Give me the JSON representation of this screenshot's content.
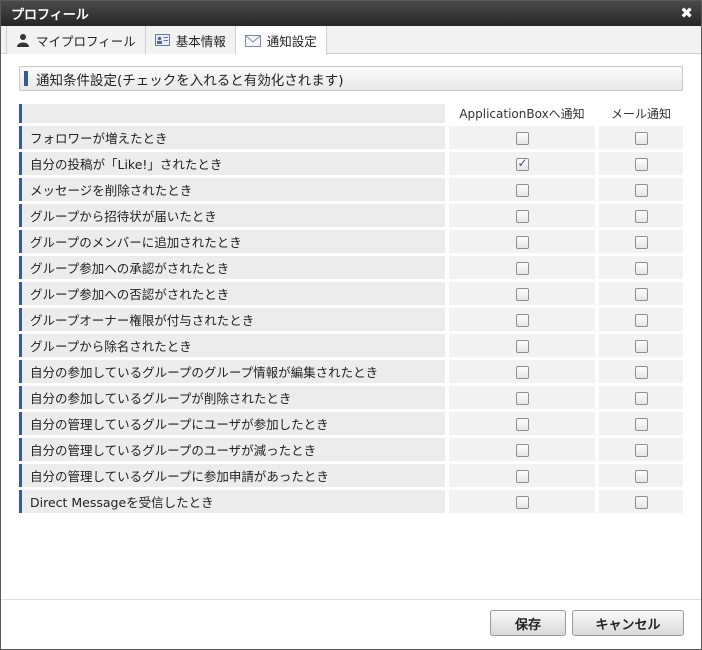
{
  "window": {
    "title": "プロフィール",
    "close_icon": "✖"
  },
  "tabs": [
    {
      "label": "マイプロフィール",
      "icon": "person-icon"
    },
    {
      "label": "基本情報",
      "icon": "id-card-icon"
    },
    {
      "label": "通知設定",
      "icon": "envelope-icon"
    }
  ],
  "section": {
    "title": "通知条件設定(チェックを入れると有効化されます)"
  },
  "columns": {
    "app": "ApplicationBoxへ通知",
    "mail": "メール通知"
  },
  "rows": [
    {
      "label": "フォロワーが増えたとき",
      "app": false,
      "mail": false
    },
    {
      "label": "自分の投稿が「Like!」されたとき",
      "app": true,
      "mail": false
    },
    {
      "label": "メッセージを削除されたとき",
      "app": false,
      "mail": false
    },
    {
      "label": "グループから招待状が届いたとき",
      "app": false,
      "mail": false
    },
    {
      "label": "グループのメンバーに追加されたとき",
      "app": false,
      "mail": false
    },
    {
      "label": "グループ参加への承認がされたとき",
      "app": false,
      "mail": false
    },
    {
      "label": "グループ参加への否認がされたとき",
      "app": false,
      "mail": false
    },
    {
      "label": "グループオーナー権限が付与されたとき",
      "app": false,
      "mail": false
    },
    {
      "label": "グループから除名されたとき",
      "app": false,
      "mail": false
    },
    {
      "label": "自分の参加しているグループのグループ情報が編集されたとき",
      "app": false,
      "mail": false
    },
    {
      "label": "自分の参加しているグループが削除されたとき",
      "app": false,
      "mail": false
    },
    {
      "label": "自分の管理しているグループにユーザが参加したとき",
      "app": false,
      "mail": false
    },
    {
      "label": "自分の管理しているグループのユーザが減ったとき",
      "app": false,
      "mail": false
    },
    {
      "label": "自分の管理しているグループに参加申請があったとき",
      "app": false,
      "mail": false
    },
    {
      "label": "Direct Messageを受信したとき",
      "app": false,
      "mail": false
    }
  ],
  "footer": {
    "save_label": "保存",
    "cancel_label": "キャンセル"
  },
  "colors": {
    "titlebar": "#2f2f2f",
    "accent": "#3a5a95",
    "check": "#3a4a8a"
  }
}
